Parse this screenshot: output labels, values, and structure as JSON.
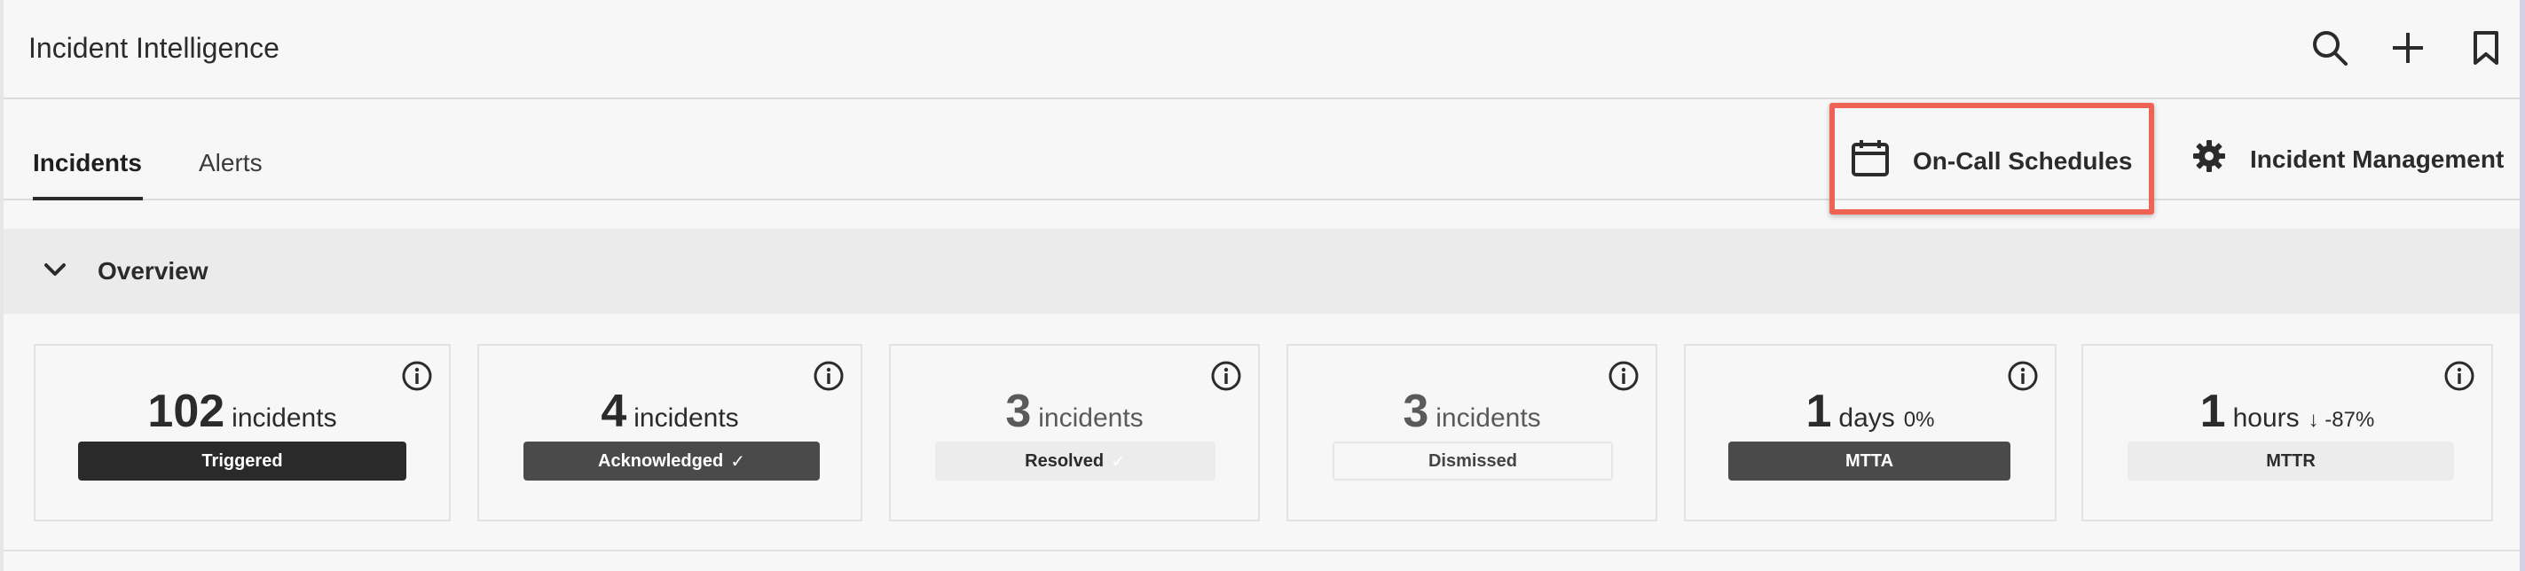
{
  "header": {
    "title": "Incident Intelligence",
    "icons": [
      "search-icon",
      "plus-icon",
      "bookmark-icon"
    ]
  },
  "tabs": [
    {
      "label": "Incidents",
      "active": true
    },
    {
      "label": "Alerts",
      "active": false
    }
  ],
  "actions": {
    "on_call": {
      "label": "On-Call Schedules",
      "icon": "calendar-icon"
    },
    "incident_management": {
      "label": "Incident Management",
      "icon": "gear-icon"
    }
  },
  "overview": {
    "title": "Overview",
    "icon": "chevron-down-icon"
  },
  "cards": [
    {
      "value": "102",
      "unit": "incidents",
      "delta": "",
      "status": "Triggered",
      "status_check": ""
    },
    {
      "value": "4",
      "unit": "incidents",
      "delta": "",
      "status": "Acknowledged",
      "status_check": "✓"
    },
    {
      "value": "3",
      "unit": "incidents",
      "delta": "",
      "status": "Resolved",
      "status_check": "✓"
    },
    {
      "value": "3",
      "unit": "incidents",
      "delta": "",
      "status": "Dismissed",
      "status_check": ""
    },
    {
      "value": "1",
      "unit": "days",
      "delta": "0%",
      "status": "MTTA",
      "status_check": ""
    },
    {
      "value": "1",
      "unit": "hours",
      "delta": "↓ -87%",
      "status": "MTTR",
      "status_check": ""
    }
  ],
  "colors": {
    "highlight": "#ef6355",
    "dark_pill": "#2a2a2a",
    "mid_pill": "#4a4a4a"
  }
}
